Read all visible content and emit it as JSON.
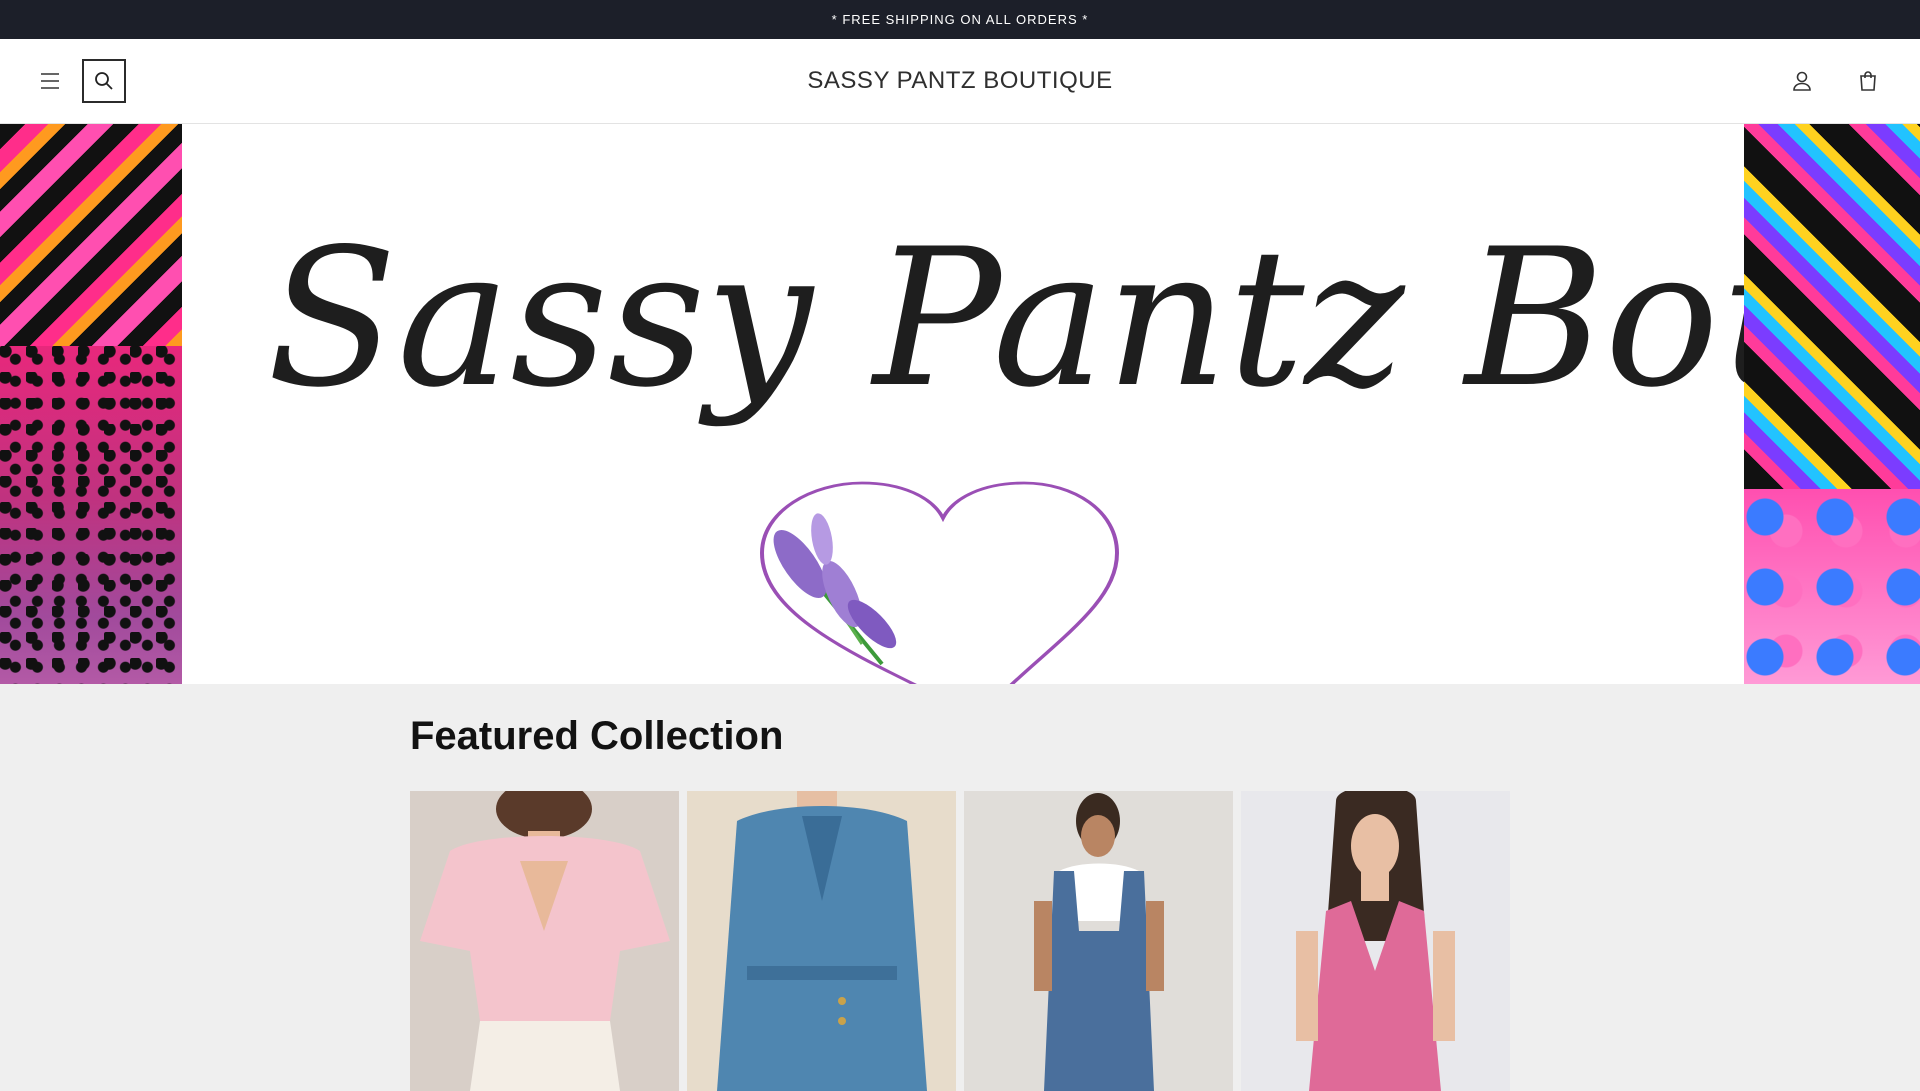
{
  "announcement": {
    "text": "* FREE SHIPPING ON ALL ORDERS *"
  },
  "header": {
    "brand": "SASSY PANTZ BOUTIQUE",
    "icons": [
      "menu-icon",
      "search-icon",
      "account-icon",
      "cart-icon"
    ]
  },
  "hero": {
    "logo_text": "Sassy Pantz Boutique",
    "image_desc_icons": [
      "heart-icon",
      "lavender-icon"
    ]
  },
  "featured": {
    "heading": "Featured Collection",
    "products": [
      {
        "icon": "product-image-pink-ruffle-top",
        "bg": "#d8cfc8",
        "garment": "#f4c4cc"
      },
      {
        "icon": "product-image-blue-denim-jumpsuit",
        "bg": "#e7dccb",
        "garment": "#4f86b0"
      },
      {
        "icon": "product-image-denim-overalls",
        "bg": "#e0ddd9",
        "garment": "#4a6f9c"
      },
      {
        "icon": "product-image-pink-romper",
        "bg": "#e8e8ec",
        "garment": "#df6a98"
      }
    ]
  },
  "colors": {
    "announcement_bg": "#1c1f29",
    "page_bg": "#efefef"
  }
}
